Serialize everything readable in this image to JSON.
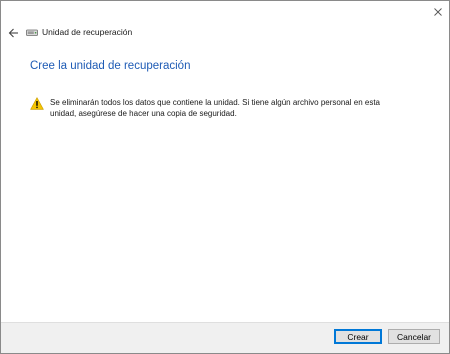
{
  "window": {
    "title": "Unidad de recuperación"
  },
  "main": {
    "heading": "Cree la unidad de recuperación",
    "warning_text": "Se eliminarán todos los datos que contiene la unidad. Si tiene algún archivo personal en esta unidad, asegúrese de hacer una copia de seguridad."
  },
  "footer": {
    "create_label": "Crear",
    "cancel_label": "Cancelar"
  },
  "colors": {
    "heading": "#1e5bb5",
    "warning_yellow": "#f5c400",
    "default_button_border": "#0078d7"
  },
  "icons": {
    "close": "close-icon",
    "back": "back-arrow-icon",
    "app": "drive-icon",
    "warning": "warning-icon"
  }
}
